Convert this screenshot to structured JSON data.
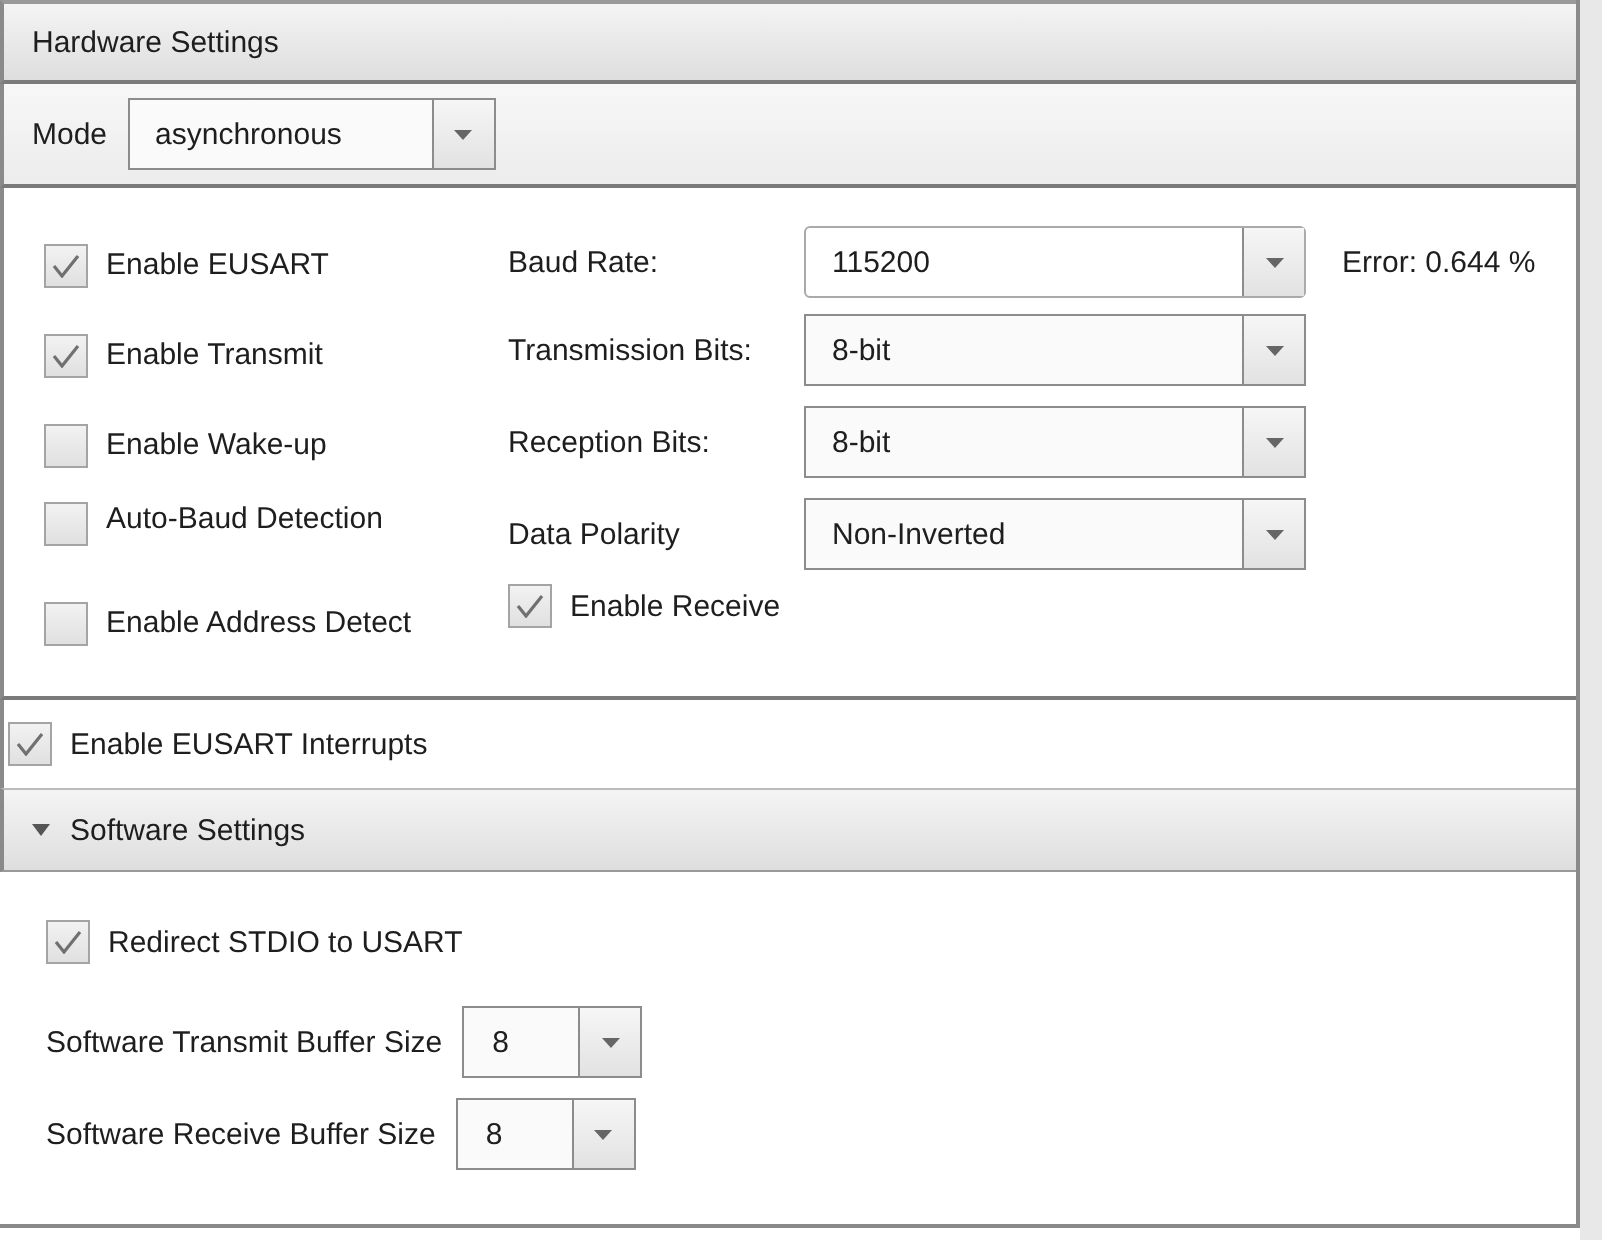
{
  "hardware_settings": {
    "title": "Hardware Settings",
    "mode": {
      "label": "Mode",
      "value": "asynchronous"
    },
    "checkboxes": [
      {
        "label": "Enable EUSART",
        "checked": true
      },
      {
        "label": "Enable Transmit",
        "checked": true
      },
      {
        "label": "Enable Wake-up",
        "checked": false
      },
      {
        "label": "Auto-Baud Detection",
        "checked": false
      },
      {
        "label": "Enable Address Detect",
        "checked": false
      }
    ],
    "fields": [
      {
        "label": "Baud Rate:",
        "value": "115200",
        "editable": true,
        "note": "Error: 0.644 %"
      },
      {
        "label": "Transmission Bits:",
        "value": "8-bit",
        "editable": false
      },
      {
        "label": "Reception Bits:",
        "value": "8-bit",
        "editable": false
      },
      {
        "label": "Data Polarity",
        "value": "Non-Inverted",
        "editable": false
      }
    ],
    "enable_receive": {
      "label": "Enable Receive",
      "checked": true
    }
  },
  "interrupts": {
    "label": "Enable EUSART Interrupts",
    "checked": true
  },
  "software_settings": {
    "title": "Software Settings",
    "expanded": true,
    "redirect": {
      "label": "Redirect STDIO to USART",
      "checked": true
    },
    "buffers": [
      {
        "label": "Software Transmit Buffer Size",
        "value": "8"
      },
      {
        "label": "Software Receive Buffer Size",
        "value": "8"
      }
    ]
  }
}
